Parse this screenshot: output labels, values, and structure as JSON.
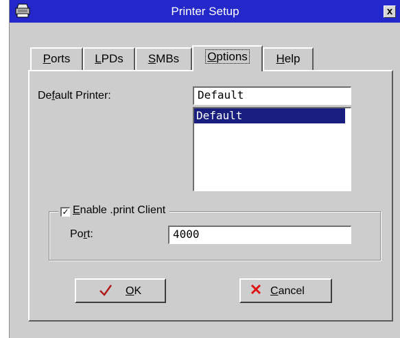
{
  "window": {
    "title": "Printer Setup",
    "close_glyph": "x",
    "app_icon": "printer-icon"
  },
  "tabs": [
    {
      "label_pre": "",
      "accel": "P",
      "label_post": "orts",
      "active": false
    },
    {
      "label_pre": "",
      "accel": "L",
      "label_post": "PDs",
      "active": false
    },
    {
      "label_pre": "",
      "accel": "S",
      "label_post": "MBs",
      "active": false
    },
    {
      "label_pre": "",
      "accel": "O",
      "label_post": "ptions",
      "active": true
    },
    {
      "label_pre": "",
      "accel": "H",
      "label_post": "elp",
      "active": false
    }
  ],
  "options": {
    "default_printer_label_pre": "De",
    "default_printer_label_accel": "f",
    "default_printer_label_post": "ault Printer:",
    "default_printer_value": "Default",
    "printer_list": [
      "Default"
    ],
    "selected_printer": "Default",
    "enable_client_checked": true,
    "enable_client_label_accel": "E",
    "enable_client_label_post": "nable .print Client",
    "port_label_pre": "Po",
    "port_label_accel": "r",
    "port_label_post": "t:",
    "port_value": "4000"
  },
  "buttons": {
    "ok_accel": "O",
    "ok_post": "K",
    "ok_icon": "checkmark-icon",
    "cancel_accel": "C",
    "cancel_post": "ancel",
    "cancel_icon": "x-mark-icon"
  },
  "colors": {
    "titlebar": "#2427c9",
    "dialog_bg": "#cdcdcd",
    "selection": "#181e7e",
    "ok_check": "#b01818",
    "cancel_x": "#e01010"
  }
}
